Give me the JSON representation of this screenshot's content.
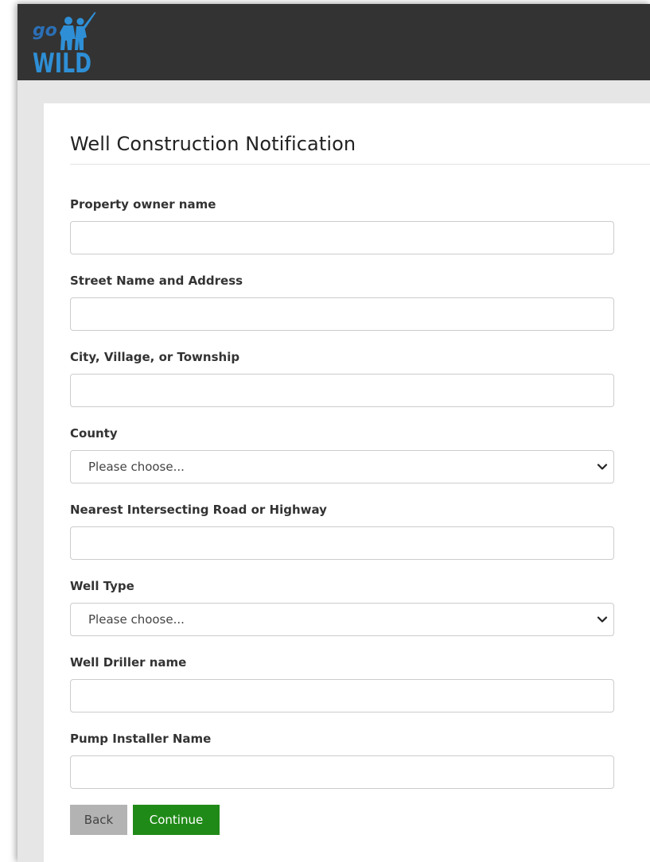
{
  "header": {
    "logo": {
      "text_top": "go",
      "text_bottom": "WILD",
      "icon": "hunter-fisher-silhouette-icon",
      "colors": {
        "text_top": "#2b6fb6",
        "text_bottom": "#2e8fd6",
        "silhouette": "#2e8fd6"
      }
    },
    "background": "#333333"
  },
  "form": {
    "title": "Well Construction Notification",
    "fields": [
      {
        "label": "Property owner name",
        "type": "text",
        "value": ""
      },
      {
        "label": "Street Name and Address",
        "type": "text",
        "value": ""
      },
      {
        "label": "City, Village, or Township",
        "type": "text",
        "value": ""
      },
      {
        "label": "County",
        "type": "select",
        "selected": "Please choose..."
      },
      {
        "label": "Nearest Intersecting Road or Highway",
        "type": "text",
        "value": ""
      },
      {
        "label": "Well Type",
        "type": "select",
        "selected": "Please choose..."
      },
      {
        "label": "Well Driller name",
        "type": "text",
        "value": ""
      },
      {
        "label": "Pump Installer Name",
        "type": "text",
        "value": ""
      }
    ],
    "buttons": {
      "back_label": "Back",
      "continue_label": "Continue"
    }
  },
  "colors": {
    "page_background": "#e6e6e6",
    "card_background": "#ffffff",
    "continue_button": "#208a18",
    "back_button": "#b3b3b3"
  },
  "icons": {
    "select_arrow": "chevron-down-icon"
  }
}
